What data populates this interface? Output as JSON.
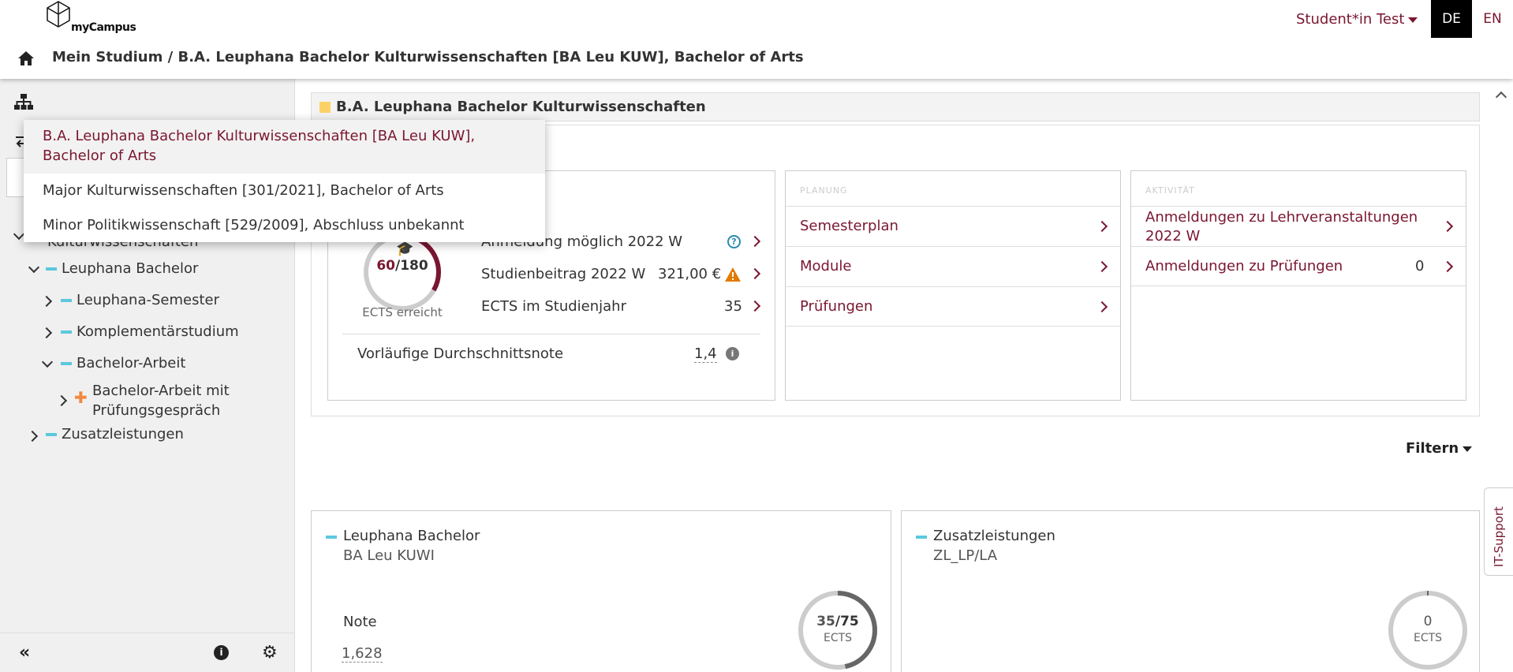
{
  "app": {
    "logo_text": "myCampus"
  },
  "header": {
    "user": "Student*in Test",
    "lang_de": "DE",
    "lang_en": "EN",
    "breadcrumb": "Mein Studium / B.A. Leuphana Bachelor Kulturwissenschaften [BA Leu KUW], Bachelor of Arts"
  },
  "dropdown": {
    "items": [
      "B.A. Leuphana Bachelor Kulturwissenschaften [BA Leu KUW], Bachelor of Arts",
      "Major Kulturwissenschaften [301/2021], Bachelor of Arts",
      "Minor Politikwissenschaft [529/2009], Abschluss unbekannt"
    ]
  },
  "sidebar": {
    "tree": [
      "Kulturwissenschaften",
      "Leuphana Bachelor",
      "Leuphana-Semester",
      "Komplementärstudium",
      "Bachelor-Arbeit",
      "Bachelor-Arbeit mit Prüfungsgespräch",
      "Zusatzleistungen"
    ]
  },
  "main": {
    "title": "B.A. Leuphana Bachelor Kulturwissenschaften",
    "progress": {
      "ects_done": "60",
      "ects_total": "/180",
      "ects_label": "ECTS erreicht",
      "fraction": 0.333
    },
    "status_rows": [
      {
        "label": "Anmeldung möglich 2022 W",
        "value": ""
      },
      {
        "label": "Studienbeitrag 2022 W",
        "value": "321,00 €"
      },
      {
        "label": "ECTS im Studienjahr",
        "value": "35"
      }
    ],
    "avg_label": "Vorläufige Durchschnittsnote",
    "avg_value": "1,4",
    "planning": {
      "label": "PLANUNG",
      "links": [
        "Semesterplan",
        "Module",
        "Prüfungen"
      ]
    },
    "activity": {
      "label": "AKTIVITÄT",
      "links": [
        {
          "label": "Anmeldungen zu Lehrveranstaltungen 2022 W",
          "count": ""
        },
        {
          "label": "Anmeldungen zu Prüfungen",
          "count": "0"
        }
      ]
    },
    "filter_label": "Filtern",
    "cards": [
      {
        "title": "Leuphana Bachelor",
        "subtitle": "BA Leu KUWI",
        "note_label": "Note",
        "note_value": "1,628",
        "ects_done": "35",
        "ects_total": "/75",
        "ects_label": "ECTS",
        "fraction": 0.467
      },
      {
        "title": "Zusatzleistungen",
        "subtitle": "ZL_LP/LA",
        "ects_done": "0",
        "ects_label": "ECTS",
        "fraction": 0.0
      }
    ],
    "it_support": "IT-Support"
  },
  "colors": {
    "accent": "#7a1630",
    "module_dash": "#5bc8dd",
    "warning": "#e07b00"
  }
}
